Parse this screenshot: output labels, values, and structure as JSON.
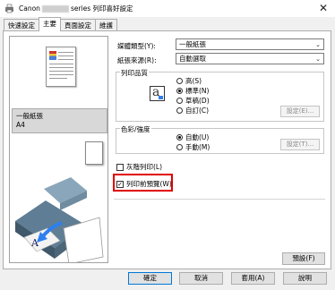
{
  "window": {
    "title_prefix": "Canon",
    "title_suffix": "series 列印喜好設定",
    "close": "✕"
  },
  "tabs": [
    {
      "label": "快速設定",
      "active": false
    },
    {
      "label": "主要",
      "active": true
    },
    {
      "label": "頁面設定",
      "active": false
    },
    {
      "label": "維護",
      "active": false
    }
  ],
  "preview": {
    "media_name": "一般紙張",
    "paper_size": "A4"
  },
  "media_type": {
    "label": "媒體類型(Y):",
    "value": "一般紙張"
  },
  "paper_source": {
    "label": "紙張來源(R):",
    "value": "自動選取"
  },
  "print_quality": {
    "title": "列印品質",
    "options": [
      {
        "label": "高(S)",
        "selected": false
      },
      {
        "label": "標準(N)",
        "selected": true
      },
      {
        "label": "草稿(D)",
        "selected": false
      },
      {
        "label": "自訂(C)",
        "selected": false
      }
    ],
    "set_button": "設定(E)..."
  },
  "color_intensity": {
    "title": "色彩/強度",
    "options": [
      {
        "label": "自動(U)",
        "selected": true
      },
      {
        "label": "手動(M)",
        "selected": false
      }
    ],
    "set_button": "設定(T)..."
  },
  "grayscale": {
    "label": "灰階列印(L)",
    "checked": false
  },
  "preview_before": {
    "label": "列印前預覽(W)",
    "checked": true
  },
  "defaults_button": "預設(F)",
  "footer_buttons": {
    "ok": "確定",
    "cancel": "取消",
    "apply": "套用(A)",
    "help": "說明"
  },
  "icons": {
    "app": "printer-app-icon",
    "quality": "letter-a-icon"
  }
}
